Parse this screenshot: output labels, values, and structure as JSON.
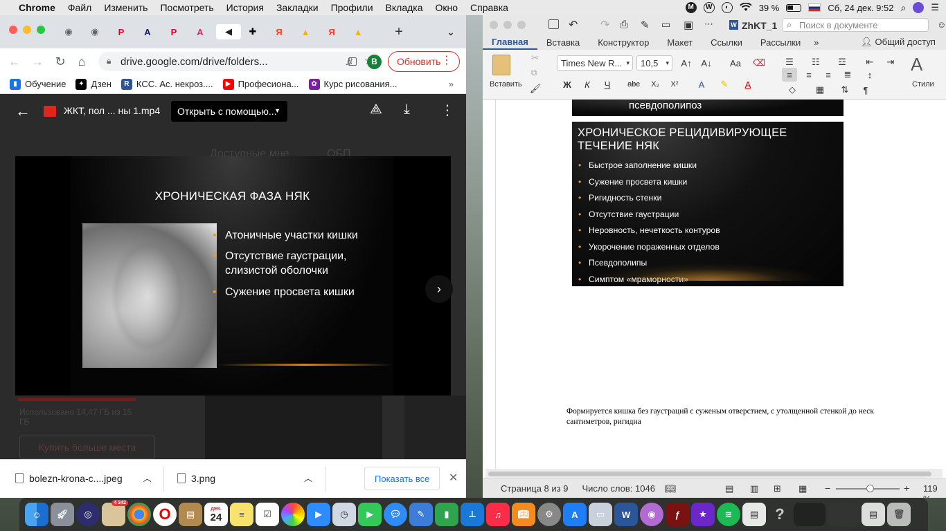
{
  "menubar": {
    "apple": "",
    "items": [
      "Chrome",
      "Файл",
      "Изменить",
      "Посмотреть",
      "История",
      "Закладки",
      "Профили",
      "Вкладка",
      "Окно",
      "Справка"
    ],
    "battery": "39 %",
    "datetime": "Сб, 24 дек.  9:52"
  },
  "chrome": {
    "url": "drive.google.com/drive/folders...",
    "update_label": "Обновить",
    "avatar_letter": "B",
    "tabs": [
      {
        "glyph": "◉",
        "color": "#5f6368"
      },
      {
        "glyph": "◉",
        "color": "#5f6368"
      },
      {
        "glyph": "P",
        "color": "#e60023"
      },
      {
        "glyph": "A",
        "color": "#1a1a6e"
      },
      {
        "glyph": "P",
        "color": "#e60023"
      },
      {
        "glyph": "A",
        "color": "#e0245e"
      },
      {
        "glyph": "◀",
        "color": "#202124"
      },
      {
        "glyph": "✚",
        "color": "#000"
      },
      {
        "glyph": "Я",
        "color": "#fc3f1d"
      },
      {
        "glyph": "▲",
        "color": "#f6b300"
      },
      {
        "glyph": "Я",
        "color": "#fc3f1d"
      },
      {
        "glyph": "▲",
        "color": "#f6b300"
      }
    ],
    "bookmarks": [
      {
        "label": "Обучение",
        "color": "#1a73e8",
        "glyph": "▮"
      },
      {
        "label": "Дзен",
        "color": "#000",
        "glyph": "✦"
      },
      {
        "label": "КСС. Ас. некроз....",
        "color": "#2f5597",
        "glyph": "R"
      },
      {
        "label": "Професиона...",
        "color": "#f00",
        "glyph": "▶"
      },
      {
        "label": "Курс рисования...",
        "color": "#7b1fa2",
        "glyph": "✿"
      }
    ]
  },
  "drive": {
    "video_title": "ЖКТ, пол ... ны 1.mp4",
    "open_with_label": "Открыть с помощью...",
    "bg_available": "Доступные мне",
    "bg_folder": "ОБП",
    "bg_storage": "Использовано 14,47 ГБ из 15 ГБ",
    "bg_buy": "Купить больше места",
    "slide": {
      "title": "ХРОНИЧЕСКАЯ ФАЗА НЯК",
      "bullets": [
        "Атоничные участки кишки",
        "Отсутствие гаустрации, слизистой оболочки",
        "Сужение просвета кишки"
      ]
    }
  },
  "downloads": {
    "items": [
      "bolezn-krona-c....jpeg",
      "3.png"
    ],
    "show_all": "Показать все"
  },
  "word": {
    "doc_name": "ZhKT_1",
    "search_placeholder": "Поиск в документе",
    "tabs": [
      "Главная",
      "Вставка",
      "Конструктор",
      "Макет",
      "Ссылки",
      "Рассылки"
    ],
    "share_label": "Общий доступ",
    "paste_label": "Вставить",
    "styles_label": "Стили",
    "font_name": "Times New R...",
    "font_size": "10,5",
    "img1_text": "псевдополипоз",
    "slide": {
      "title": "ХРОНИЧЕСКОЕ РЕЦИДИВИРУЮЩЕЕ ТЕЧЕНИЕ НЯК",
      "bullets": [
        "Быстрое заполнение кишки",
        "Сужение просвета кишки",
        "Ригидность стенки",
        "Отсутствие гаустрации",
        "Неровность, нечеткость контуров",
        "Укорочение пораженных отделов",
        "Псевдополипы",
        "Симптом «мраморности»"
      ]
    },
    "body_text": "Формируется кишка без гаустраций с суженым отверстием, с утолщенной стенкой до неск сантиметров, ригидна",
    "status_page": "Страница 8 из 9",
    "status_words": "Число слов: 1046",
    "zoom": "119 %"
  },
  "dock": {
    "date_month": "ДЕК.",
    "date_day": "24",
    "badge": "4 242"
  }
}
